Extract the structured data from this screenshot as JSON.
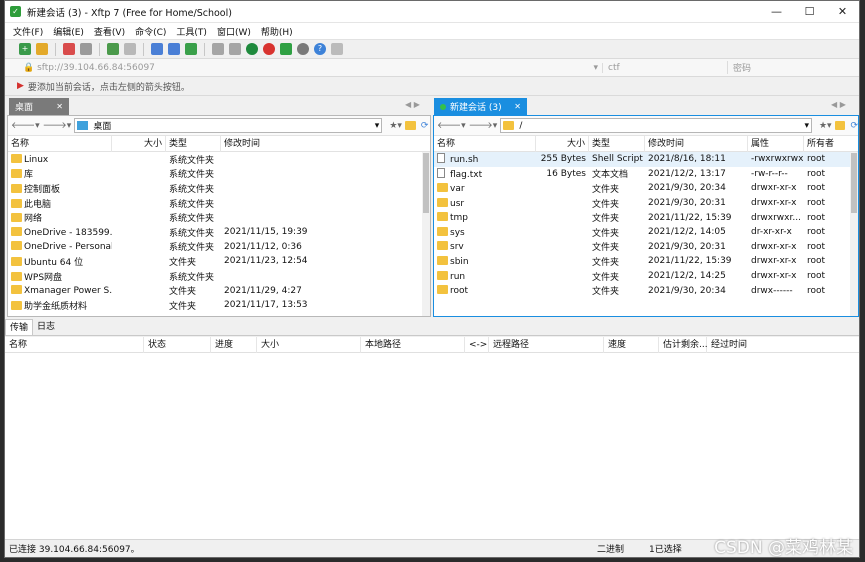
{
  "window": {
    "title": "新建会话 (3) - Xftp 7 (Free for Home/School)",
    "min": "—",
    "max": "☐",
    "close": "✕"
  },
  "menu": [
    "文件(F)",
    "编辑(E)",
    "查看(V)",
    "命令(C)",
    "工具(T)",
    "窗口(W)",
    "帮助(H)"
  ],
  "address": {
    "host": "sftp://39.104.66.84:56097",
    "user": "ctf",
    "password": "密码"
  },
  "hint": "要添加当前会话，点击左侧的箭头按钮。",
  "tabs": {
    "left": "桌面",
    "right": "新建会话 (3)"
  },
  "left": {
    "path": "桌面",
    "headers": [
      "名称",
      "大小",
      "类型",
      "修改时间"
    ],
    "rows": [
      [
        "Linux",
        "",
        "系统文件夹",
        ""
      ],
      [
        "库",
        "",
        "系统文件夹",
        ""
      ],
      [
        "控制面板",
        "",
        "系统文件夹",
        ""
      ],
      [
        "此电脑",
        "",
        "系统文件夹",
        ""
      ],
      [
        "网络",
        "",
        "系统文件夹",
        ""
      ],
      [
        "OneDrive - 183599...",
        "",
        "系统文件夹",
        "2021/11/15, 19:39"
      ],
      [
        "OneDrive - Personal",
        "",
        "系统文件夹",
        "2021/11/12, 0:36"
      ],
      [
        "Ubuntu 64 位",
        "",
        "文件夹",
        "2021/11/23, 12:54"
      ],
      [
        "WPS网盘",
        "",
        "系统文件夹",
        ""
      ],
      [
        "Xmanager Power S...",
        "",
        "文件夹",
        "2021/11/29, 4:27"
      ],
      [
        "助学金纸质材料",
        "",
        "文件夹",
        "2021/11/17, 13:53"
      ]
    ]
  },
  "right": {
    "path": "/",
    "headers": [
      "名称",
      "大小",
      "类型",
      "修改时间",
      "属性",
      "所有者"
    ],
    "rows": [
      [
        "run.sh",
        "255 Bytes",
        "Shell Script",
        "2021/8/16, 18:11",
        "-rwxrwxrwx",
        "root"
      ],
      [
        "flag.txt",
        "16 Bytes",
        "文本文档",
        "2021/12/2, 13:17",
        "-rw-r--r--",
        "root"
      ],
      [
        "var",
        "",
        "文件夹",
        "2021/9/30, 20:34",
        "drwxr-xr-x",
        "root"
      ],
      [
        "usr",
        "",
        "文件夹",
        "2021/9/30, 20:31",
        "drwxr-xr-x",
        "root"
      ],
      [
        "tmp",
        "",
        "文件夹",
        "2021/11/22, 15:39",
        "drwxrwxr...",
        "root"
      ],
      [
        "sys",
        "",
        "文件夹",
        "2021/12/2, 14:05",
        "dr-xr-xr-x",
        "root"
      ],
      [
        "srv",
        "",
        "文件夹",
        "2021/9/30, 20:31",
        "drwxr-xr-x",
        "root"
      ],
      [
        "sbin",
        "",
        "文件夹",
        "2021/11/22, 15:39",
        "drwxr-xr-x",
        "root"
      ],
      [
        "run",
        "",
        "文件夹",
        "2021/12/2, 14:25",
        "drwxr-xr-x",
        "root"
      ],
      [
        "root",
        "",
        "文件夹",
        "2021/9/30, 20:34",
        "drwx------",
        "root"
      ]
    ]
  },
  "bottom": {
    "tabs": [
      "传输",
      "日志"
    ],
    "headers": [
      "名称",
      "状态",
      "进度",
      "大小",
      "本地路径",
      "<->",
      "远程路径",
      "速度",
      "估计剩余...",
      "经过时间"
    ]
  },
  "status": {
    "left": "已连接 39.104.66.84:56097。",
    "mode": "二进制",
    "selected": "1已选择"
  },
  "watermark": "CSDN @菜鸡林某"
}
